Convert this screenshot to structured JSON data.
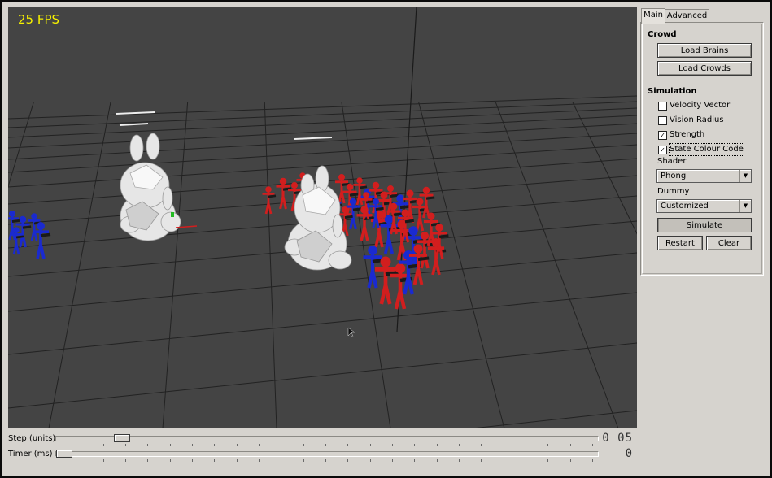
{
  "viewport": {
    "fps_label": "25 FPS"
  },
  "tabs": [
    {
      "label": "Main"
    },
    {
      "label": "Advanced"
    }
  ],
  "crowd": {
    "heading": "Crowd",
    "load_brains": "Load Brains",
    "load_crowds": "Load Crowds"
  },
  "simulation": {
    "heading": "Simulation",
    "options": [
      {
        "label": "Velocity Vector",
        "checked": false
      },
      {
        "label": "Vision Radius",
        "checked": false
      },
      {
        "label": "Strength",
        "checked": true
      },
      {
        "label": "State Colour Code",
        "checked": true
      }
    ],
    "shader": {
      "label": "Shader",
      "value": "Phong"
    },
    "dummy": {
      "label": "Dummy",
      "value": "Customized"
    },
    "simulate": "Simulate",
    "restart": "Restart",
    "clear": "Clear"
  },
  "controls": {
    "step": {
      "label": "Step (units)",
      "value": "0.05",
      "fraction": 0.11
    },
    "timer": {
      "label": "Timer (ms)",
      "value": "0",
      "fraction": 0.0
    }
  },
  "colors": {
    "fps": "#f5f000",
    "viewport_bg": "#444444",
    "agent_red": "#d21e1e",
    "agent_blue": "#1a2ad0",
    "model": "#e6e6e6"
  }
}
